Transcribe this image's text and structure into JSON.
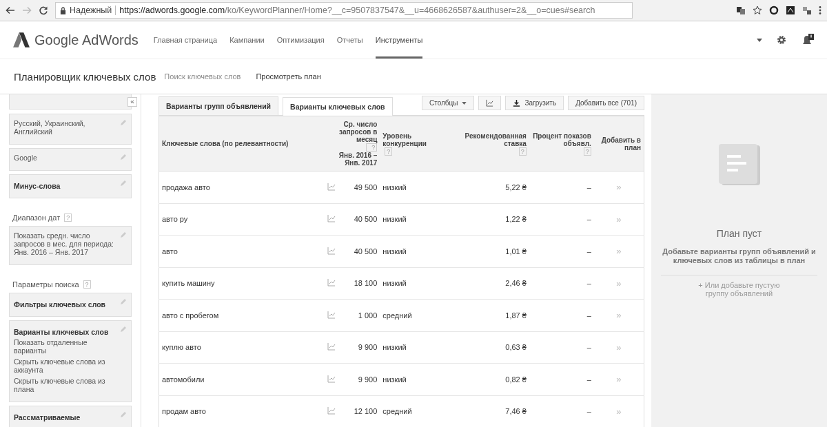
{
  "browser": {
    "security": "Надежный",
    "url_host": "https://adwords.google.com",
    "url_path": "/ko/KeywordPlanner/Home?__c=9507837547&__u=4668626587&authuser=2&__o=cues#search"
  },
  "header": {
    "logo": "Google AdWords",
    "nav": [
      {
        "label": "Главная страница",
        "selected": false
      },
      {
        "label": "Кампании",
        "selected": false
      },
      {
        "label": "Оптимизация",
        "selected": false
      },
      {
        "label": "Отчеты",
        "selected": false
      },
      {
        "label": "Инструменты",
        "selected": true
      }
    ]
  },
  "subheader": {
    "title": "Планировщик ключевых слов",
    "links": [
      "Поиск ключевых слов",
      "Просмотреть план"
    ]
  },
  "sidebar": {
    "collapse": "«",
    "groups": [
      {
        "cards": [
          {
            "kind": "cut"
          },
          {
            "kind": "setting",
            "lines": [
              "Русский, Украинский, Английский"
            ]
          },
          {
            "kind": "setting",
            "lines": [
              "Google"
            ]
          },
          {
            "kind": "setting",
            "title": "Минус-слова"
          }
        ]
      },
      {
        "heading": "Диапазон дат",
        "help": "?",
        "cards": [
          {
            "kind": "setting",
            "lines": [
              "Показать средн. число запросов в мес. для периода: Янв. 2016 – Янв. 2017"
            ]
          }
        ]
      },
      {
        "heading": "Параметры поиска",
        "help": "?",
        "cards": [
          {
            "kind": "setting",
            "title": "Фильтры ключевых слов"
          },
          {
            "kind": "setting",
            "title": "Варианты ключевых слов",
            "lines": [
              "Показать отдаленные варианты",
              "Скрыть ключевые слова из аккаунта",
              "Скрыть ключевые слова из плана"
            ]
          },
          {
            "kind": "setting",
            "title": "Рассматриваемые"
          }
        ]
      }
    ]
  },
  "table": {
    "tabs": [
      {
        "label": "Варианты групп объявлений",
        "selected": false
      },
      {
        "label": "Варианты ключевых слов",
        "selected": true
      }
    ],
    "tools": {
      "columns": "Столбцы",
      "download": "Загрузить",
      "add_all": "Добавить все (701)"
    },
    "columns": [
      {
        "label": "Ключевые слова (по релевантности)"
      },
      {
        "label": "Ср. число запросов в месяц",
        "help": "?",
        "sub": "Янв. 2016 – Янв. 2017"
      },
      {
        "label": "Уровень конкуренции",
        "help": "?"
      },
      {
        "label": "Рекомендованная ставка",
        "help": "?"
      },
      {
        "label": "Процент показов объявл.",
        "help": "?"
      },
      {
        "label": "Добавить в план"
      }
    ],
    "rows": [
      {
        "keyword": "продажа авто",
        "searches": "49 500",
        "competition": "низкий",
        "bid": "5,22 ₴",
        "share": "–",
        "add": "»"
      },
      {
        "keyword": "авто ру",
        "searches": "40 500",
        "competition": "низкий",
        "bid": "1,22 ₴",
        "share": "–",
        "add": "»"
      },
      {
        "keyword": "авто",
        "searches": "40 500",
        "competition": "низкий",
        "bid": "1,01 ₴",
        "share": "–",
        "add": "»"
      },
      {
        "keyword": "купить машину",
        "searches": "18 100",
        "competition": "низкий",
        "bid": "2,46 ₴",
        "share": "–",
        "add": "»"
      },
      {
        "keyword": "авто с пробегом",
        "searches": "1 000",
        "competition": "средний",
        "bid": "1,87 ₴",
        "share": "–",
        "add": "»"
      },
      {
        "keyword": "куплю авто",
        "searches": "9 900",
        "competition": "низкий",
        "bid": "0,63 ₴",
        "share": "–",
        "add": "»"
      },
      {
        "keyword": "автомобили",
        "searches": "9 900",
        "competition": "низкий",
        "bid": "0,82 ₴",
        "share": "–",
        "add": "»"
      },
      {
        "keyword": "продам авто",
        "searches": "12 100",
        "competition": "средний",
        "bid": "7,46 ₴",
        "share": "–",
        "add": "»"
      }
    ]
  },
  "plan": {
    "title": "План пуст",
    "text": "Добавьте варианты групп объявлений и ключевых слов из таблицы в план",
    "link": "+ Или добавьте пустую группу объявлений"
  }
}
